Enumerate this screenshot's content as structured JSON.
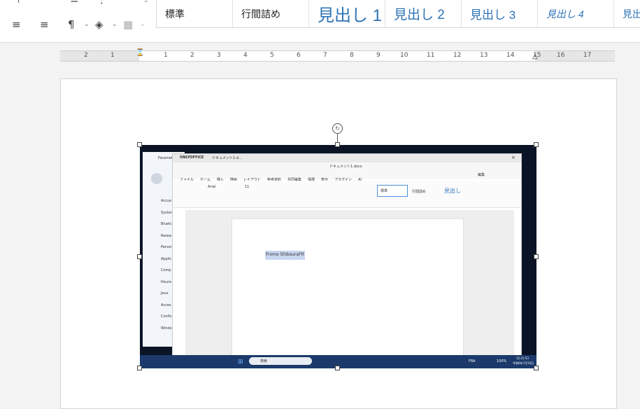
{
  "toolbar": {
    "icons": {
      "row1": [
        "align-top-icon",
        "line-spacing-icon",
        "list-icon"
      ],
      "row2": [
        "align-right-icon",
        "justify-icon",
        "pilcrow-icon",
        "fill-bucket-icon",
        "border-icon"
      ]
    }
  },
  "styles": [
    {
      "label": "標準"
    },
    {
      "label": "行間詰め"
    },
    {
      "label": "見出し 1"
    },
    {
      "label": "見出し 2"
    },
    {
      "label": "見出し 3"
    },
    {
      "label": "見出し 4"
    },
    {
      "label": "見出し"
    }
  ],
  "ruler": {
    "left_numbers": [
      "2",
      "1"
    ],
    "right_numbers": [
      "1",
      "2",
      "3",
      "4",
      "5",
      "6",
      "7",
      "8",
      "9",
      "10",
      "11",
      "12",
      "13",
      "14",
      "15",
      "16",
      "17"
    ]
  },
  "embedded": {
    "settings_window": {
      "title": "Paramet",
      "menu": [
        "Accue",
        "Syster",
        "Bluetc",
        "Resea",
        "Persor",
        "Applic",
        "Comp",
        "Heure",
        "Jeux",
        "Acces",
        "Confic",
        "Windo"
      ]
    },
    "editor": {
      "app_name": "ONLYOFFICE",
      "doc_tab": "ドキュメント1.d...",
      "title": "ドキュメント1.docx",
      "menu": [
        "ファイル",
        "ホーム",
        "挿入",
        "描画",
        "レイアウト",
        "参考資料",
        "共同編集",
        "保護",
        "表示",
        "プラグイン",
        "AI"
      ],
      "font": "Arial",
      "size": "11",
      "style_boxes": [
        "標準",
        "行間詰め",
        "見出し"
      ],
      "doc_text": "Frome ShibauraFR",
      "edit_mode": "編集"
    },
    "taskbar": {
      "search_placeholder": "検索",
      "lang": "FRA",
      "battery": "100%",
      "time": "12:21:53",
      "date": "令和6年7月10日"
    }
  },
  "colors": {
    "accent": "#1a73e8",
    "heading": "#2e74b5",
    "desktop": "#0b1326",
    "taskbar": "#1b3a6b"
  }
}
